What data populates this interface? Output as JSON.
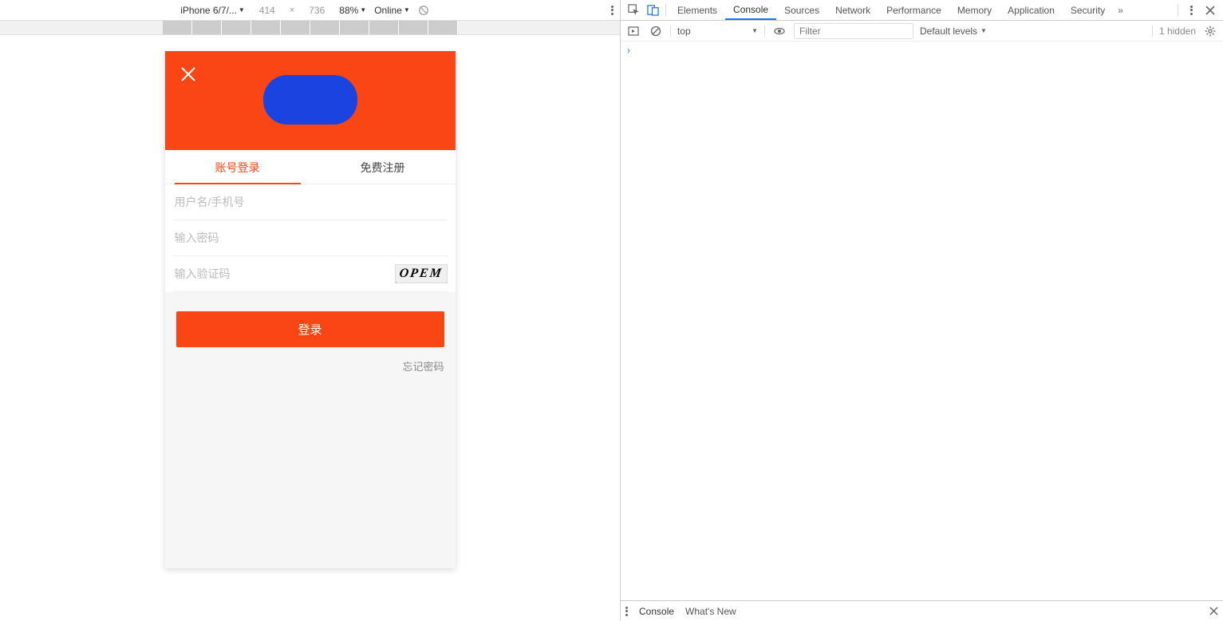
{
  "device_toolbar": {
    "device": "iPhone 6/7/...",
    "width": "414",
    "height": "736",
    "zoom": "88%",
    "network": "Online"
  },
  "app": {
    "tabs": {
      "login": "账号登录",
      "register": "免费注册"
    },
    "placeholders": {
      "username": "用户名/手机号",
      "password": "输入密码",
      "captcha": "输入验证码"
    },
    "captcha_text": "OPEM",
    "login_btn": "登录",
    "forgot": "忘记密码"
  },
  "devtools": {
    "tabs": [
      "Elements",
      "Console",
      "Sources",
      "Network",
      "Performance",
      "Memory",
      "Application",
      "Security"
    ],
    "active_tab": "Console",
    "console_toolbar": {
      "context": "top",
      "filter_placeholder": "Filter",
      "levels": "Default levels",
      "hidden": "1 hidden"
    },
    "drawer": {
      "tab1": "Console",
      "tab2": "What's New"
    }
  }
}
